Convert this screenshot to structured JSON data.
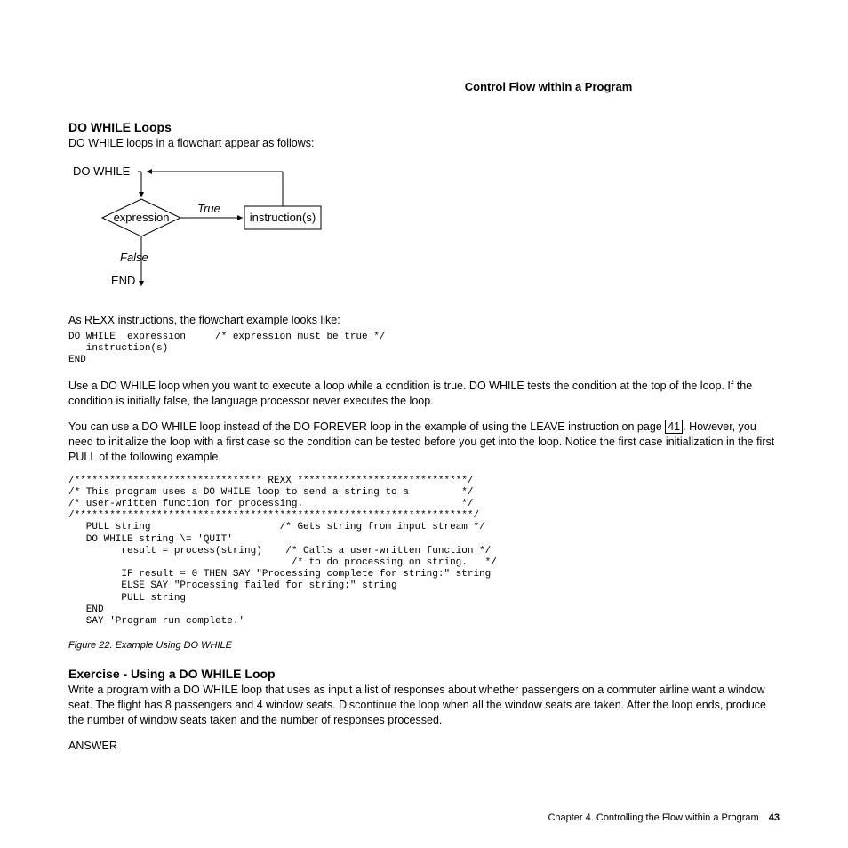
{
  "running_head": "Control Flow within a Program",
  "h_do_while": "DO WHILE Loops",
  "p_intro": "DO WHILE loops in a flowchart appear as follows:",
  "flow": {
    "do_while": "DO WHILE",
    "expression": "expression",
    "true": "True",
    "instructions": "instruction(s)",
    "false": "False",
    "end": "END"
  },
  "p_as_rexx": "As REXX instructions, the flowchart example looks like:",
  "code1": "DO WHILE  expression     /* expression must be true */\n   instruction(s)\nEND",
  "p_use": "Use a DO WHILE loop when you want to execute a loop while a condition is true. DO WHILE tests the condition at the top of the loop. If the condition is initially false, the language processor never executes the loop.",
  "p_instead_a": "You can use a DO WHILE loop instead of the DO FOREVER loop in the example of using the LEAVE instruction on page ",
  "page_link": "41",
  "p_instead_b": ". However, you need to initialize the loop with a first case so the condition can be tested before you get into the loop. Notice the first case initialization in the first PULL of the following example.",
  "code2": "/******************************** REXX *****************************/\n/* This program uses a DO WHILE loop to send a string to a         */\n/* user-written function for processing.                           */\n/********************************************************************/\n   PULL string                      /* Gets string from input stream */\n   DO WHILE string \\= 'QUIT'\n         result = process(string)    /* Calls a user-written function */\n                                      /* to do processing on string.   */\n         IF result = 0 THEN SAY \"Processing complete for string:\" string\n         ELSE SAY \"Processing failed for string:\" string\n         PULL string\n   END\n   SAY 'Program run complete.'",
  "fig_caption": "Figure 22. Example Using DO WHILE",
  "h_exercise": "Exercise - Using a DO WHILE Loop",
  "p_exercise": "Write a program with a DO WHILE loop that uses as input a list of responses about whether passengers on a commuter airline want a window seat. The flight has 8 passengers and 4 window seats. Discontinue the loop when all the window seats are taken. After the loop ends, produce the number of window seats taken and the number of responses processed.",
  "p_answer": "ANSWER",
  "footer_chapter": "Chapter 4. Controlling the Flow within a Program",
  "footer_page": "43"
}
